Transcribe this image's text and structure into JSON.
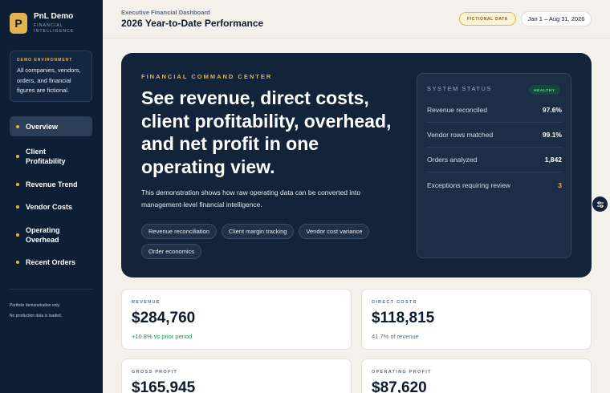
{
  "brand": {
    "initial": "P",
    "name": "PnL Demo",
    "subtitle": "FINANCIAL INTELLIGENCE"
  },
  "demo": {
    "label": "DEMO ENVIRONMENT",
    "text": "All companies, vendors, orders, and financial figures are fictional."
  },
  "nav": [
    {
      "label": "Overview",
      "active": true
    },
    {
      "label": "Client Profitability"
    },
    {
      "label": "Revenue Trend"
    },
    {
      "label": "Vendor Costs"
    },
    {
      "label": "Operating Overhead"
    },
    {
      "label": "Recent Orders"
    }
  ],
  "sidebar_footer": {
    "line1": "Portfolio demonstration only.",
    "line2": "No production data is loaded."
  },
  "header": {
    "subtitle": "Executive Financial Dashboard",
    "title": "2026 Year-to-Date Performance",
    "badge": "FICTIONAL DATA",
    "date_range": "Jan 1 – Aug 31, 2026"
  },
  "hero": {
    "kicker": "FINANCIAL COMMAND CENTER",
    "headline": "See revenue, direct costs, client profitability, overhead, and net profit in one operating view.",
    "description": "This demonstration shows how raw operating data can be converted into management-level financial intelligence.",
    "pills": [
      "Revenue reconciliation",
      "Client margin tracking",
      "Vendor cost variance",
      "Order economics"
    ]
  },
  "status": {
    "title": "SYSTEM STATUS",
    "badge": "HEALTHY",
    "rows": [
      {
        "label": "Revenue reconciled",
        "value": "97.6%"
      },
      {
        "label": "Vendor rows matched",
        "value": "99.1%"
      },
      {
        "label": "Orders analyzed",
        "value": "1,842"
      },
      {
        "label": "Exceptions requiring review",
        "value": "3"
      }
    ]
  },
  "kpis": {
    "revenue": {
      "label": "REVENUE",
      "value": "$284,760",
      "note": "+10.8% vs prior period"
    },
    "direct_costs": {
      "label": "DIRECT COSTS",
      "value": "$118,815",
      "note": "41.7% of revenue"
    },
    "gross_profit": {
      "label": "GROSS PROFIT",
      "value": "$165,945"
    },
    "operating_profit": {
      "label": "OPERATING PROFIT",
      "value": "$87,620"
    }
  },
  "colors": {
    "navy": "#0e1e34",
    "gold": "#e2b351",
    "positive": "#1c8a52",
    "background": "#f4f1ea"
  },
  "icons": {
    "floating_button": "settings-sliders-icon"
  }
}
